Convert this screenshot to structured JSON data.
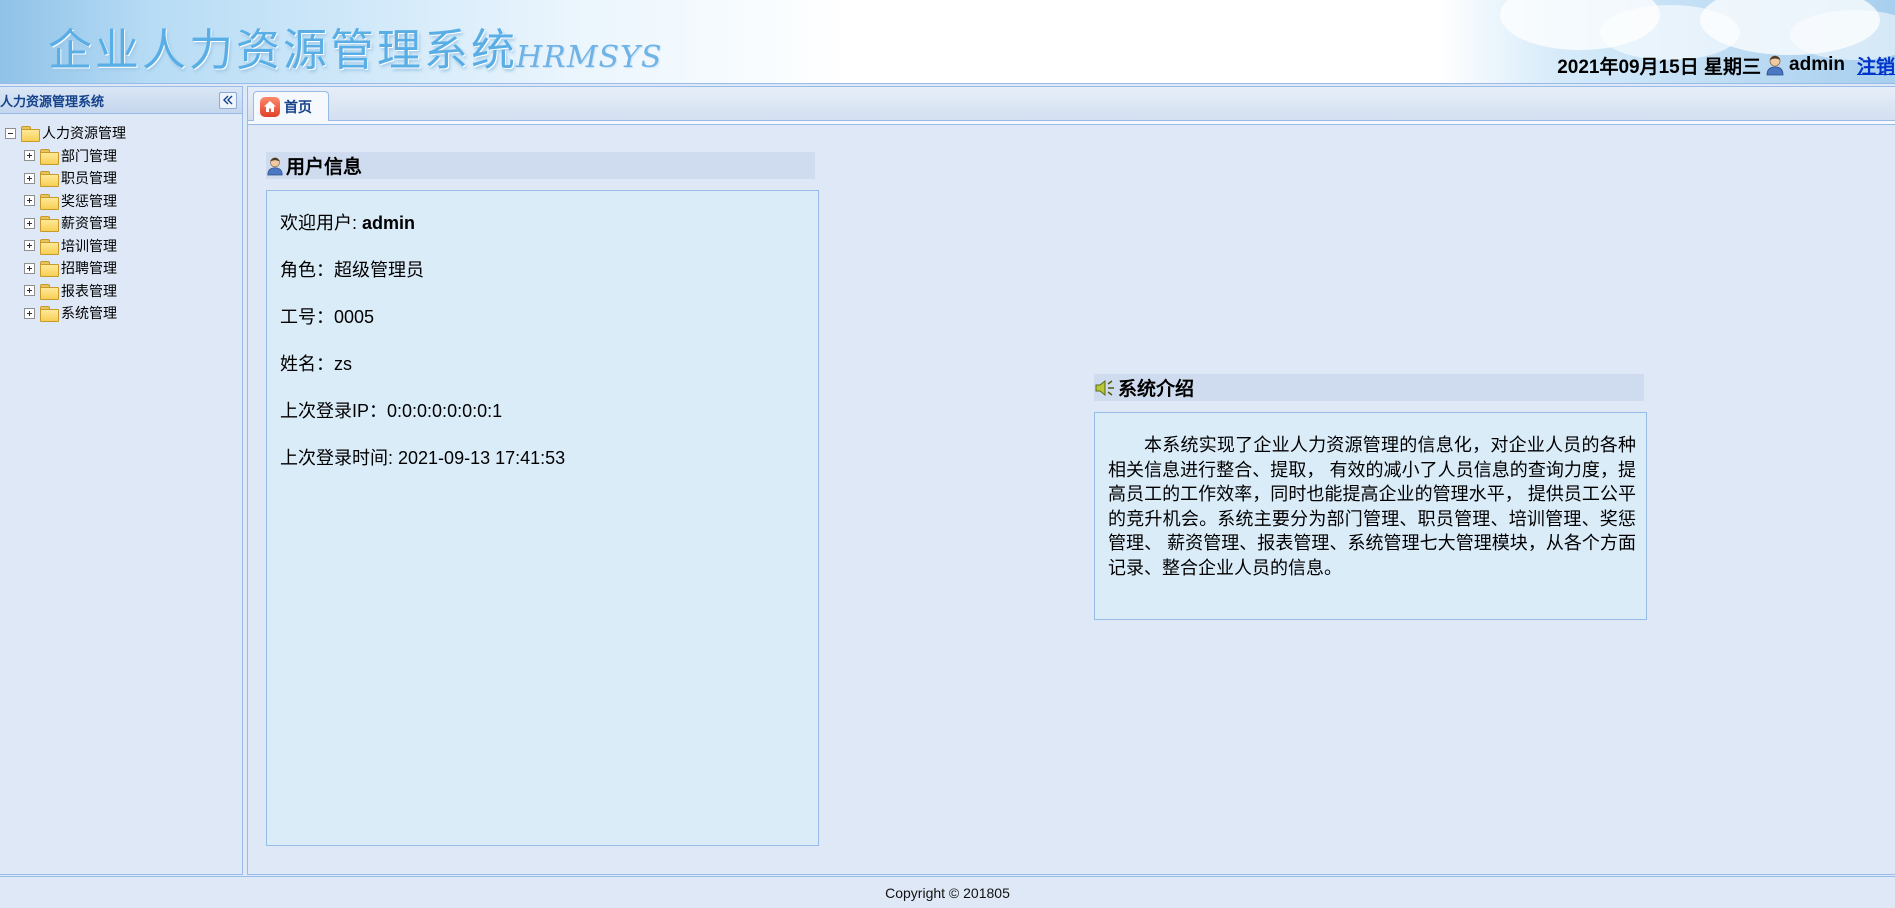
{
  "header": {
    "title": "企业人力资源管理系统",
    "subtitle": "HRMSYS",
    "date": "2021年09月15日 星期三",
    "username": "admin",
    "logout_label": "注销"
  },
  "sidebar": {
    "title": "人力资源管理系统",
    "root_label": "人力资源管理",
    "items": [
      {
        "label": "部门管理"
      },
      {
        "label": "职员管理"
      },
      {
        "label": "奖惩管理"
      },
      {
        "label": "薪资管理"
      },
      {
        "label": "培训管理"
      },
      {
        "label": "招聘管理"
      },
      {
        "label": "报表管理"
      },
      {
        "label": "系统管理"
      }
    ]
  },
  "tabs": [
    {
      "label": "首页",
      "active": true
    }
  ],
  "user_info": {
    "heading": "用户信息",
    "welcome_label": "欢迎用户: ",
    "welcome_value": "admin",
    "role_label": "角色：",
    "role_value": "超级管理员",
    "id_label": "工号：",
    "id_value": "0005",
    "name_label": "姓名：",
    "name_value": "zs",
    "ip_label": "上次登录IP：",
    "ip_value": "0:0:0:0:0:0:0:1",
    "time_label": "上次登录时间: ",
    "time_value": "2021-09-13 17:41:53"
  },
  "intro": {
    "heading": "系统介绍",
    "text": "本系统实现了企业人力资源管理的信息化，对企业人员的各种相关信息进行整合、提取， 有效的减小了人员信息的查询力度，提高员工的工作效率，同时也能提高企业的管理水平， 提供员工公平的竞升机会。系统主要分为部门管理、职员管理、培训管理、奖惩管理、 薪资管理、报表管理、系统管理七大管理模块，从各个方面记录、整合企业人员的信息。"
  },
  "footer": {
    "copyright": "Copyright © 201805"
  },
  "icons": {
    "user": "user-icon",
    "home": "home-icon",
    "speaker": "speaker-icon",
    "folder": "folder-icon",
    "collapse": "double-chevron-left-icon"
  }
}
